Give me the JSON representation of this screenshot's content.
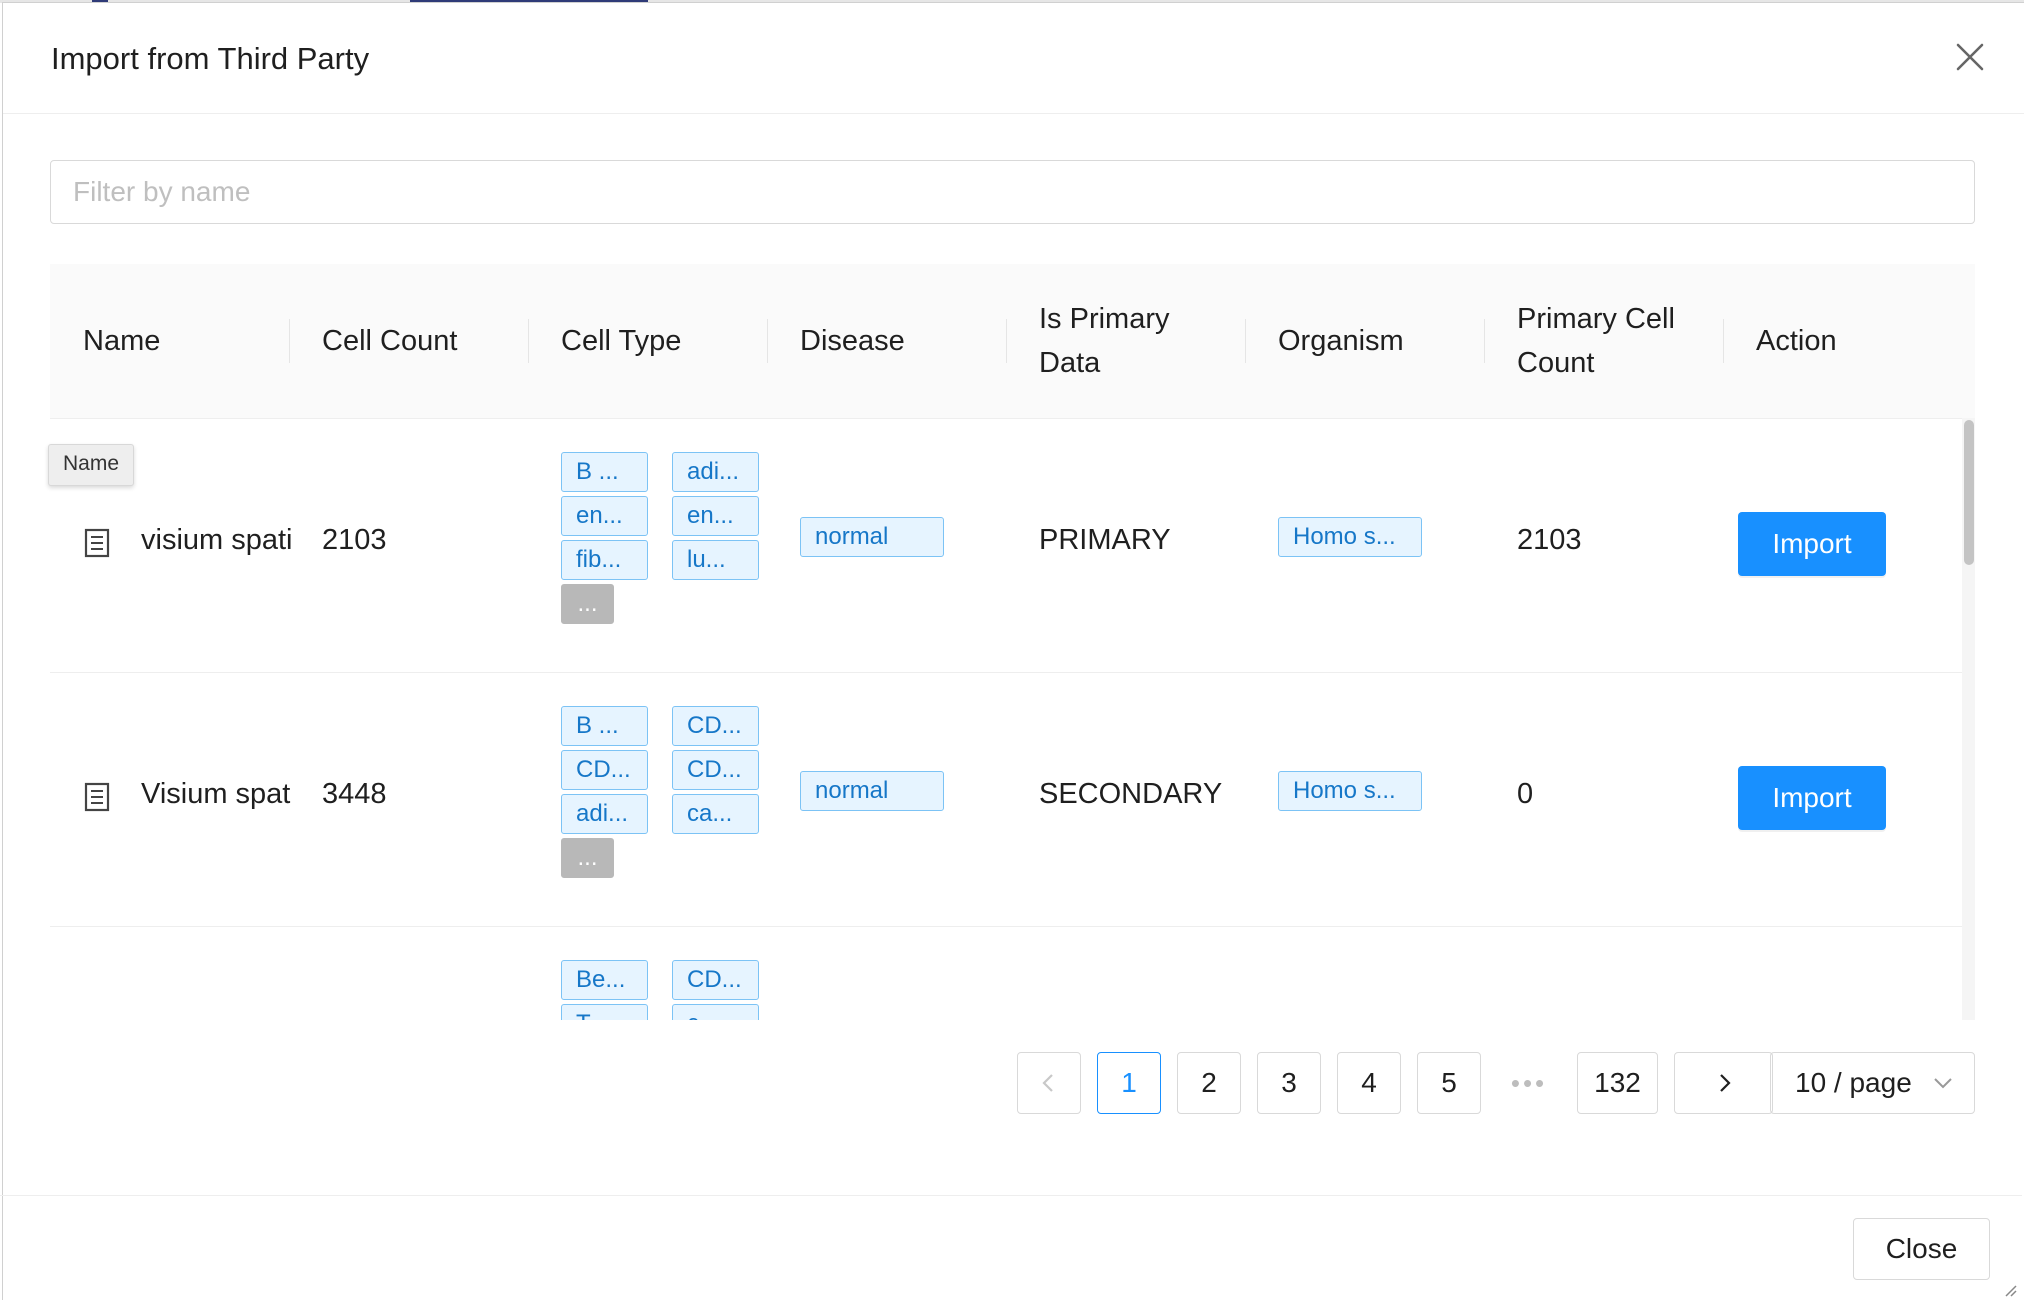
{
  "modal": {
    "title": "Import from Third Party"
  },
  "filter": {
    "placeholder": "Filter by name"
  },
  "table": {
    "columns": {
      "name": "Name",
      "cell_count": "Cell Count",
      "cell_type": "Cell Type",
      "disease": "Disease",
      "is_primary_line1": "Is Primary",
      "is_primary_line2": "Data",
      "organism": "Organism",
      "primary_cell_count_line1": "Primary Cell",
      "primary_cell_count_line2": "Count",
      "action": "Action"
    },
    "rows": [
      {
        "name": "visium spati",
        "cell_count": "2103",
        "cell_types": [
          "B ...",
          "adi...",
          "en...",
          "en...",
          "fib...",
          "lu..."
        ],
        "more": "...",
        "disease": "normal",
        "is_primary": "PRIMARY",
        "organism": "Homo s...",
        "primary_cell_count": "2103",
        "action": "Import"
      },
      {
        "name": "Visium spat",
        "cell_count": "3448",
        "cell_types": [
          "B ...",
          "CD...",
          "CD...",
          "CD...",
          "adi...",
          "ca..."
        ],
        "more": "...",
        "disease": "normal",
        "is_primary": "SECONDARY",
        "organism": "Homo s...",
        "primary_cell_count": "0",
        "action": "Import"
      },
      {
        "cell_types": [
          "Be...",
          "CD...",
          "T...",
          "c..."
        ]
      }
    ]
  },
  "tooltip": {
    "text": "Name"
  },
  "pagination": {
    "pages": [
      "1",
      "2",
      "3",
      "4",
      "5"
    ],
    "ellipsis": "•••",
    "last_page": "132",
    "current_page": "1",
    "page_size": "10 / page"
  },
  "footer": {
    "close_label": "Close"
  },
  "colors": {
    "primary": "#1890ff",
    "tag_border": "#7cc3f5",
    "tag_bg": "#e6f4ff",
    "tag_text": "#1677c8"
  }
}
